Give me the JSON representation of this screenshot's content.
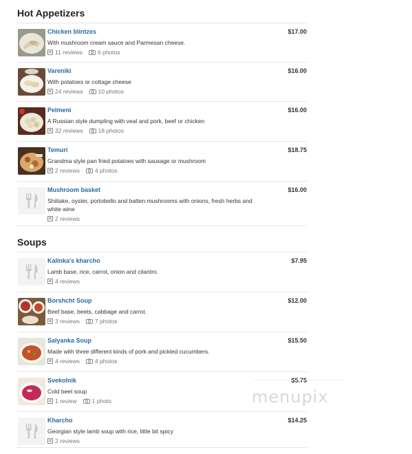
{
  "sections": [
    {
      "title": "Hot Appetizers",
      "items": [
        {
          "name": "Chicken blintzes",
          "price": "$17.00",
          "desc": "With mushroom cream sauce and Parmesan cheese.",
          "reviews": "11 reviews",
          "photos": "6 photos",
          "img": "blintz"
        },
        {
          "name": "Vareniki",
          "price": "$16.00",
          "desc": "With potatoes or cottage cheese",
          "reviews": "24 reviews",
          "photos": "10 photos",
          "img": "vareniki"
        },
        {
          "name": "Pelmeni",
          "price": "$16.00",
          "desc": "A Russian style dumpling with veal and pork, beef or chicken",
          "reviews": "32 reviews",
          "photos": "18 photos",
          "img": "pelmeni"
        },
        {
          "name": "Temuri",
          "price": "$18.75",
          "desc": "Grandma style pan fried potatoes with sausage or mushroom",
          "reviews": "2 reviews",
          "photos": "4 photos",
          "img": "temuri"
        },
        {
          "name": "Mushroom basket",
          "price": "$16.00",
          "desc": "Shiitake, oyster, portobello and batten mushrooms with onions, fresh herbs and white wine",
          "reviews": "2 reviews",
          "photos": "",
          "img": "placeholder"
        }
      ]
    },
    {
      "title": "Soups",
      "items": [
        {
          "name": "Kalinka's kharcho",
          "price": "$7.95",
          "desc": "Lamb base, rice, carrot, onion and cilantro.",
          "reviews": "4 reviews",
          "photos": "",
          "img": "placeholder"
        },
        {
          "name": "Borshcht Soup",
          "price": "$12.00",
          "desc": "Beef base, beets, cabbage and carrot.",
          "reviews": "3 reviews",
          "photos": "7 photos",
          "img": "borscht"
        },
        {
          "name": "Salyanka Soup",
          "price": "$15.50",
          "desc": "Made with three different kinds of pork and pickled cucumbers.",
          "reviews": "4 reviews",
          "photos": "4 photos",
          "img": "salyanka"
        },
        {
          "name": "Svekolnik",
          "price": "$5.75",
          "desc": "Cold beet soup",
          "reviews": "1 review",
          "photos": "1 photo",
          "img": "svekolnik"
        },
        {
          "name": "Kharcho",
          "price": "$14.25",
          "desc": "Georgian style lamb soup with rice, little bit spicy",
          "reviews": "2 reviews",
          "photos": "",
          "img": "placeholder"
        }
      ]
    }
  ],
  "watermark": "menupix"
}
